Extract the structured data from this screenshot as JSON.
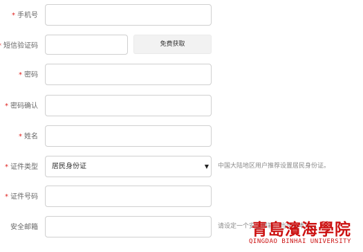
{
  "form": {
    "phone": {
      "label": "手机号",
      "required": true,
      "value": ""
    },
    "sms_code": {
      "label": "短信验证码",
      "required": true,
      "value": "",
      "button_label": "免费获取"
    },
    "password": {
      "label": "密码",
      "required": true,
      "value": ""
    },
    "password_confirm": {
      "label": "密码确认",
      "required": true,
      "value": ""
    },
    "name": {
      "label": "姓名",
      "required": true,
      "value": ""
    },
    "id_type": {
      "label": "证件类型",
      "required": true,
      "selected": "居民身份证",
      "hint": "中国大陆地区用户推荐设置居民身份证。"
    },
    "id_number": {
      "label": "证件号码",
      "required": true,
      "value": ""
    },
    "email": {
      "label": "安全邮箱",
      "required": false,
      "value": "",
      "hint": "请设定一个安全邮箱，当您在本站..."
    }
  },
  "required_mark": "*",
  "select_arrow": "▼",
  "watermark": {
    "cn": "青島濱海學院",
    "en": "QINGDAO BINHAI UNIVERSITY",
    "color": "#cc1111"
  },
  "colors": {
    "required": "#e0201d",
    "border": "#cfcfcf",
    "button_bg": "#f2f2f2"
  }
}
